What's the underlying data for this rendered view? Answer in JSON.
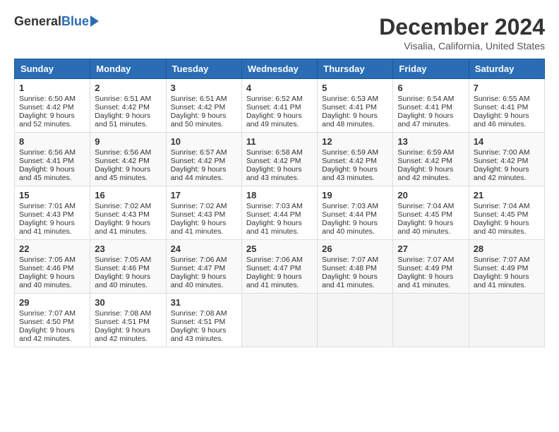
{
  "header": {
    "logo_general": "General",
    "logo_blue": "Blue",
    "month_title": "December 2024",
    "location": "Visalia, California, United States"
  },
  "days_of_week": [
    "Sunday",
    "Monday",
    "Tuesday",
    "Wednesday",
    "Thursday",
    "Friday",
    "Saturday"
  ],
  "weeks": [
    [
      {
        "day": "1",
        "sunrise": "6:50 AM",
        "sunset": "4:42 PM",
        "daylight": "9 hours and 52 minutes."
      },
      {
        "day": "2",
        "sunrise": "6:51 AM",
        "sunset": "4:42 PM",
        "daylight": "9 hours and 51 minutes."
      },
      {
        "day": "3",
        "sunrise": "6:51 AM",
        "sunset": "4:42 PM",
        "daylight": "9 hours and 50 minutes."
      },
      {
        "day": "4",
        "sunrise": "6:52 AM",
        "sunset": "4:41 PM",
        "daylight": "9 hours and 49 minutes."
      },
      {
        "day": "5",
        "sunrise": "6:53 AM",
        "sunset": "4:41 PM",
        "daylight": "9 hours and 48 minutes."
      },
      {
        "day": "6",
        "sunrise": "6:54 AM",
        "sunset": "4:41 PM",
        "daylight": "9 hours and 47 minutes."
      },
      {
        "day": "7",
        "sunrise": "6:55 AM",
        "sunset": "4:41 PM",
        "daylight": "9 hours and 46 minutes."
      }
    ],
    [
      {
        "day": "8",
        "sunrise": "6:56 AM",
        "sunset": "4:41 PM",
        "daylight": "9 hours and 45 minutes."
      },
      {
        "day": "9",
        "sunrise": "6:56 AM",
        "sunset": "4:42 PM",
        "daylight": "9 hours and 45 minutes."
      },
      {
        "day": "10",
        "sunrise": "6:57 AM",
        "sunset": "4:42 PM",
        "daylight": "9 hours and 44 minutes."
      },
      {
        "day": "11",
        "sunrise": "6:58 AM",
        "sunset": "4:42 PM",
        "daylight": "9 hours and 43 minutes."
      },
      {
        "day": "12",
        "sunrise": "6:59 AM",
        "sunset": "4:42 PM",
        "daylight": "9 hours and 43 minutes."
      },
      {
        "day": "13",
        "sunrise": "6:59 AM",
        "sunset": "4:42 PM",
        "daylight": "9 hours and 42 minutes."
      },
      {
        "day": "14",
        "sunrise": "7:00 AM",
        "sunset": "4:42 PM",
        "daylight": "9 hours and 42 minutes."
      }
    ],
    [
      {
        "day": "15",
        "sunrise": "7:01 AM",
        "sunset": "4:43 PM",
        "daylight": "9 hours and 41 minutes."
      },
      {
        "day": "16",
        "sunrise": "7:02 AM",
        "sunset": "4:43 PM",
        "daylight": "9 hours and 41 minutes."
      },
      {
        "day": "17",
        "sunrise": "7:02 AM",
        "sunset": "4:43 PM",
        "daylight": "9 hours and 41 minutes."
      },
      {
        "day": "18",
        "sunrise": "7:03 AM",
        "sunset": "4:44 PM",
        "daylight": "9 hours and 41 minutes."
      },
      {
        "day": "19",
        "sunrise": "7:03 AM",
        "sunset": "4:44 PM",
        "daylight": "9 hours and 40 minutes."
      },
      {
        "day": "20",
        "sunrise": "7:04 AM",
        "sunset": "4:45 PM",
        "daylight": "9 hours and 40 minutes."
      },
      {
        "day": "21",
        "sunrise": "7:04 AM",
        "sunset": "4:45 PM",
        "daylight": "9 hours and 40 minutes."
      }
    ],
    [
      {
        "day": "22",
        "sunrise": "7:05 AM",
        "sunset": "4:46 PM",
        "daylight": "9 hours and 40 minutes."
      },
      {
        "day": "23",
        "sunrise": "7:05 AM",
        "sunset": "4:46 PM",
        "daylight": "9 hours and 40 minutes."
      },
      {
        "day": "24",
        "sunrise": "7:06 AM",
        "sunset": "4:47 PM",
        "daylight": "9 hours and 40 minutes."
      },
      {
        "day": "25",
        "sunrise": "7:06 AM",
        "sunset": "4:47 PM",
        "daylight": "9 hours and 41 minutes."
      },
      {
        "day": "26",
        "sunrise": "7:07 AM",
        "sunset": "4:48 PM",
        "daylight": "9 hours and 41 minutes."
      },
      {
        "day": "27",
        "sunrise": "7:07 AM",
        "sunset": "4:49 PM",
        "daylight": "9 hours and 41 minutes."
      },
      {
        "day": "28",
        "sunrise": "7:07 AM",
        "sunset": "4:49 PM",
        "daylight": "9 hours and 41 minutes."
      }
    ],
    [
      {
        "day": "29",
        "sunrise": "7:07 AM",
        "sunset": "4:50 PM",
        "daylight": "9 hours and 42 minutes."
      },
      {
        "day": "30",
        "sunrise": "7:08 AM",
        "sunset": "4:51 PM",
        "daylight": "9 hours and 42 minutes."
      },
      {
        "day": "31",
        "sunrise": "7:08 AM",
        "sunset": "4:51 PM",
        "daylight": "9 hours and 43 minutes."
      },
      null,
      null,
      null,
      null
    ]
  ]
}
